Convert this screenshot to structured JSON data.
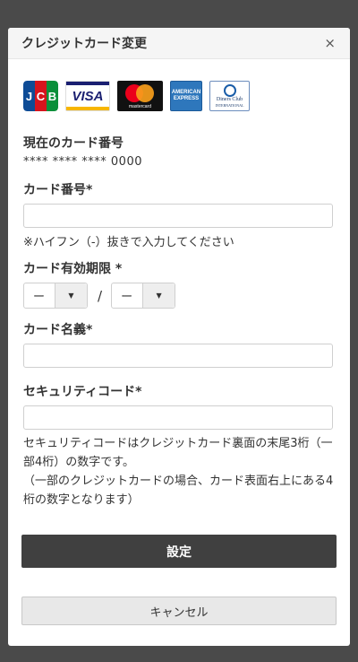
{
  "modal": {
    "title": "クレジットカード変更",
    "close_label": "×"
  },
  "brands": [
    {
      "name": "JCB",
      "letters": [
        "J",
        "C",
        "B"
      ],
      "colors": [
        "#0e4c96",
        "#d7141d",
        "#0a8f3a"
      ]
    },
    {
      "name": "VISA",
      "text": "VISA",
      "colors": [
        "#1a1f71",
        "#f7b600"
      ]
    },
    {
      "name": "mastercard",
      "text": "mastercard",
      "colors": [
        "#eb001b",
        "#f79e1b"
      ]
    },
    {
      "name": "AMERICAN EXPRESS",
      "text": "AMERICAN EXPRESS",
      "color": "#2e77bc"
    },
    {
      "name": "Diners Club International",
      "text": "Diners Club",
      "subtext": "INTERNATIONAL",
      "color": "#1a5da8"
    }
  ],
  "current_card": {
    "label": "現在のカード番号",
    "value": "**** **** **** 0000"
  },
  "card_number": {
    "label": "カード番号*",
    "value": "",
    "hint": "※ハイフン（-）抜きで入力してください"
  },
  "expiry": {
    "label": "カード有効期限 *",
    "month": "ー",
    "year": "ー",
    "separator": "/",
    "caret": "▼"
  },
  "card_holder": {
    "label": "カード名義*",
    "value": ""
  },
  "security_code": {
    "label": "セキュリティコード*",
    "value": "",
    "note_line1": "セキュリティコードはクレジットカード裏面の末尾3桁（一部4桁）の数字です。",
    "note_line2": "（一部のクレジットカードの場合、カード表面右上にある4桁の数字となります）"
  },
  "actions": {
    "submit_label": "設定",
    "cancel_label": "キャンセル"
  }
}
